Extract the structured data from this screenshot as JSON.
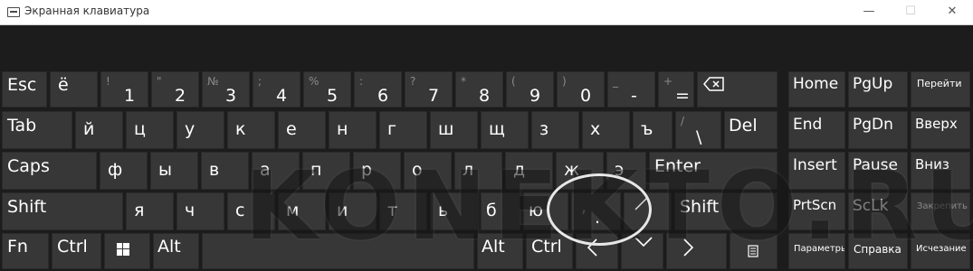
{
  "window": {
    "title": "Экранная клавиатура",
    "controls": {
      "minimize": "—",
      "maximize": "☐",
      "close": "✕"
    }
  },
  "watermark": "KONEKTO.RU",
  "keyboard": {
    "row1": {
      "esc": "Esc",
      "yo": "ё",
      "k1": {
        "main": "1",
        "alt": "!"
      },
      "k2": {
        "main": "2",
        "alt": "\""
      },
      "k3": {
        "main": "3",
        "alt": "№"
      },
      "k4": {
        "main": "4",
        "alt": ";"
      },
      "k5": {
        "main": "5",
        "alt": "%"
      },
      "k6": {
        "main": "6",
        "alt": ":"
      },
      "k7": {
        "main": "7",
        "alt": "?"
      },
      "k8": {
        "main": "8",
        "alt": "*"
      },
      "k9": {
        "main": "9",
        "alt": "("
      },
      "k0": {
        "main": "0",
        "alt": ")"
      },
      "minus": {
        "main": "-",
        "alt": "_"
      },
      "equals": {
        "main": "=",
        "alt": "+"
      }
    },
    "row2": {
      "tab": "Tab",
      "letters": [
        "й",
        "ц",
        "у",
        "к",
        "е",
        "н",
        "г",
        "ш",
        "щ",
        "з",
        "х",
        "ъ"
      ],
      "backslash": {
        "main": "\\",
        "alt": "/"
      },
      "del": "Del"
    },
    "row3": {
      "caps": "Caps",
      "letters": [
        "ф",
        "ы",
        "в",
        "а",
        "п",
        "р",
        "о",
        "л",
        "д",
        "ж",
        "э"
      ],
      "enter": "Enter"
    },
    "row4": {
      "shift_left": "Shift",
      "letters": [
        "я",
        "ч",
        "с",
        "м",
        "и",
        "т",
        "ь",
        "б",
        "ю"
      ],
      "comma": ",",
      "period": ".",
      "slash": "/",
      "shift_right": "Shift"
    },
    "row5": {
      "fn": "Fn",
      "ctrl_left": "Ctrl",
      "alt_left": "Alt",
      "alt_right": "Alt",
      "ctrl_right": "Ctrl"
    },
    "nav": {
      "home": "Home",
      "pgup": "PgUp",
      "goto": "Перейти",
      "end": "End",
      "pgdn": "PgDn",
      "up": "Вверх",
      "insert": "Insert",
      "pause": "Pause",
      "down": "Вниз",
      "prtscn": "PrtScn",
      "sclk": "ScLk",
      "dock": "Закрепить",
      "options": "Параметры",
      "help": "Справка",
      "fade": "Исчезание"
    }
  }
}
